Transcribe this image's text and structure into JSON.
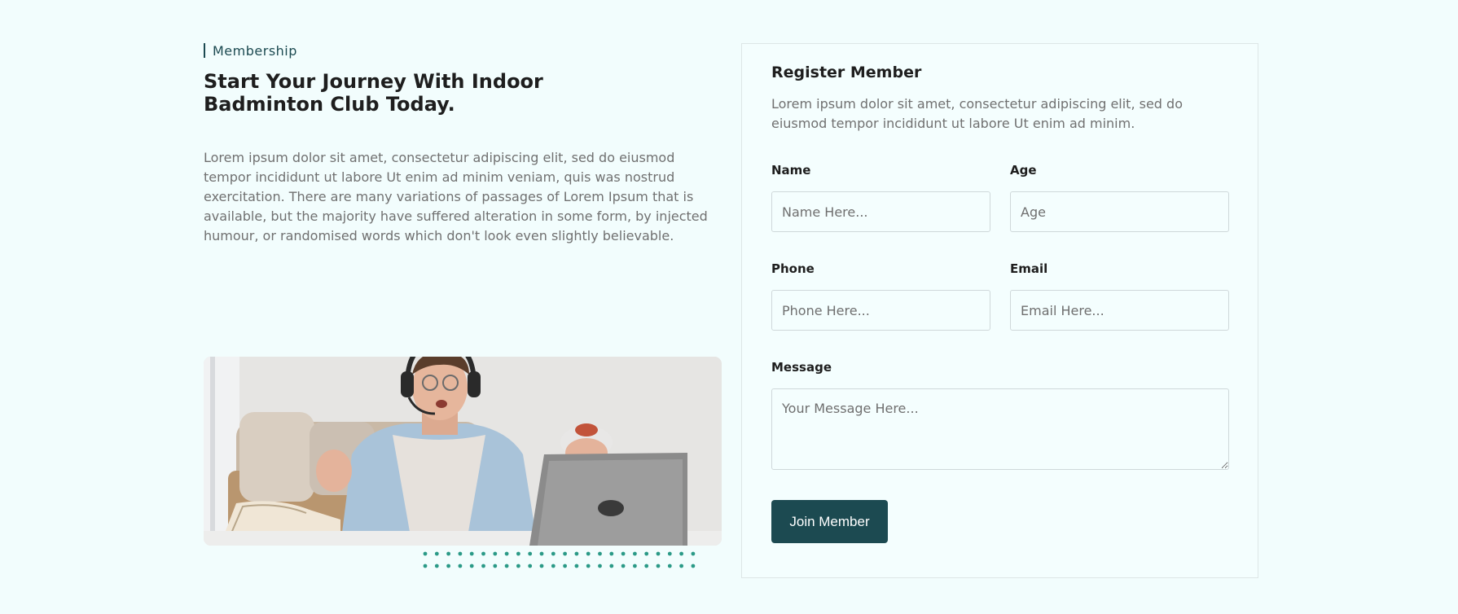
{
  "membership": {
    "eyebrow": "Membership",
    "headline": "Start Your Journey With Indoor Badminton Club Today.",
    "body": "Lorem ipsum dolor sit amet, consectetur adipiscing elit, sed do eiusmod tempor incididunt ut labore Ut enim ad minim veniam, quis was nostrud exercitation. There are many variations of passages of Lorem Ipsum that is available, but the majority have suffered alteration in some form, by injected humour, or randomised words which don't look even slightly believable."
  },
  "register": {
    "title": "Register Member",
    "description": "Lorem ipsum dolor sit amet, consectetur adipiscing elit, sed do eiusmod tempor incididunt ut labore Ut enim ad minim.",
    "fields": {
      "name": {
        "label": "Name",
        "placeholder": "Name Here..."
      },
      "age": {
        "label": "Age",
        "placeholder": "Age"
      },
      "phone": {
        "label": "Phone",
        "placeholder": "Phone Here..."
      },
      "email": {
        "label": "Email",
        "placeholder": "Email Here..."
      },
      "message": {
        "label": "Message",
        "placeholder": "Your Message Here..."
      }
    },
    "submit_label": "Join Member"
  },
  "colors": {
    "page_background": "#f2fdfd",
    "accent": "#1c4a51",
    "body_text": "#707070",
    "heading_text": "#1e1e1e",
    "dot_pattern": "#2b9a87"
  }
}
